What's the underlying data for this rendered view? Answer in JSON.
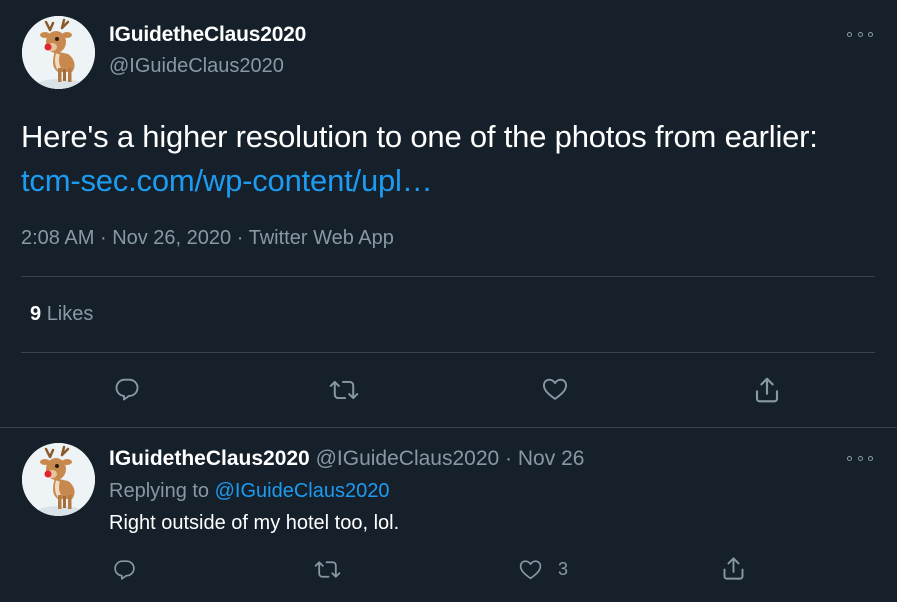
{
  "main_tweet": {
    "display_name": "IGuidetheClaus2020",
    "handle": "@IGuideClaus2020",
    "text_prefix": "Here's a higher resolution to one of the photos from earlier: ",
    "link_text": "tcm-sec.com/wp-content/upl…",
    "time": "2:08 AM",
    "date": "Nov 26, 2020",
    "source": "Twitter Web App",
    "separator": "·",
    "likes_count": "9",
    "likes_label": "Likes",
    "icons": [
      "more-icon",
      "reply-icon",
      "retweet-icon",
      "like-icon",
      "share-icon"
    ]
  },
  "reply_tweet": {
    "display_name": "IGuidetheClaus2020",
    "handle": "@IGuideClaus2020",
    "separator": "·",
    "date": "Nov 26",
    "replying_label": "Replying to",
    "replying_to": "@IGuideClaus2020",
    "text": "Right outside of my hotel too, lol.",
    "like_count": "3"
  },
  "colors": {
    "background": "#15202b",
    "text": "#ffffff",
    "secondary": "#8899a6",
    "link": "#1d9bf0",
    "divider": "#38444d"
  }
}
